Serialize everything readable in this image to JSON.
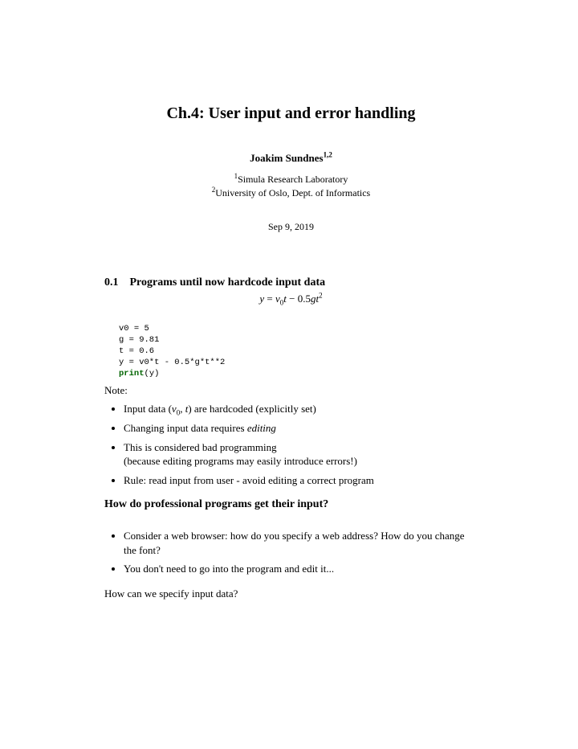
{
  "title": "Ch.4: User input and error handling",
  "author": {
    "name": "Joakim Sundnes",
    "sup": "1,2"
  },
  "affiliations": {
    "a1_sup": "1",
    "a1": "Simula Research Laboratory",
    "a2_sup": "2",
    "a2": "University of Oslo, Dept. of Informatics"
  },
  "date": "Sep 9, 2019",
  "section": {
    "number": "0.1",
    "title": "Programs until now hardcode input data"
  },
  "equation": {
    "lhs": "y",
    "eq": " = ",
    "v_var": "v",
    "v_sub": "0",
    "t1": "t",
    "minus": " − 0.5",
    "g": "g",
    "t2": "t",
    "t2_sup": "2"
  },
  "code": {
    "l1": "v0 = 5",
    "l2": "g = 9.81",
    "l3": "t = 0.6",
    "l4": "y = v0*t - 0.5*g*t**2",
    "l5a": "print",
    "l5b": "(y)"
  },
  "note_label": "Note:",
  "bullets1": {
    "b1_pre": "Input data (",
    "b1_v": "v",
    "b1_vsub": "0",
    "b1_mid": ", ",
    "b1_t": "t",
    "b1_post": ") are hardcoded (explicitly set)",
    "b2_pre": "Changing input data requires ",
    "b2_em": "editing",
    "b3_l1": "This is considered bad programming",
    "b3_l2": "(because editing programs may easily introduce errors!)",
    "b4": "Rule: read input from user - avoid editing a correct program"
  },
  "subheading": "How do professional programs get their input?",
  "bullets2": {
    "b1": "Consider a web browser: how do you specify a web address? How do you change the font?",
    "b2": "You don't need to go into the program and edit it..."
  },
  "closing_q": "How can we specify input data?"
}
